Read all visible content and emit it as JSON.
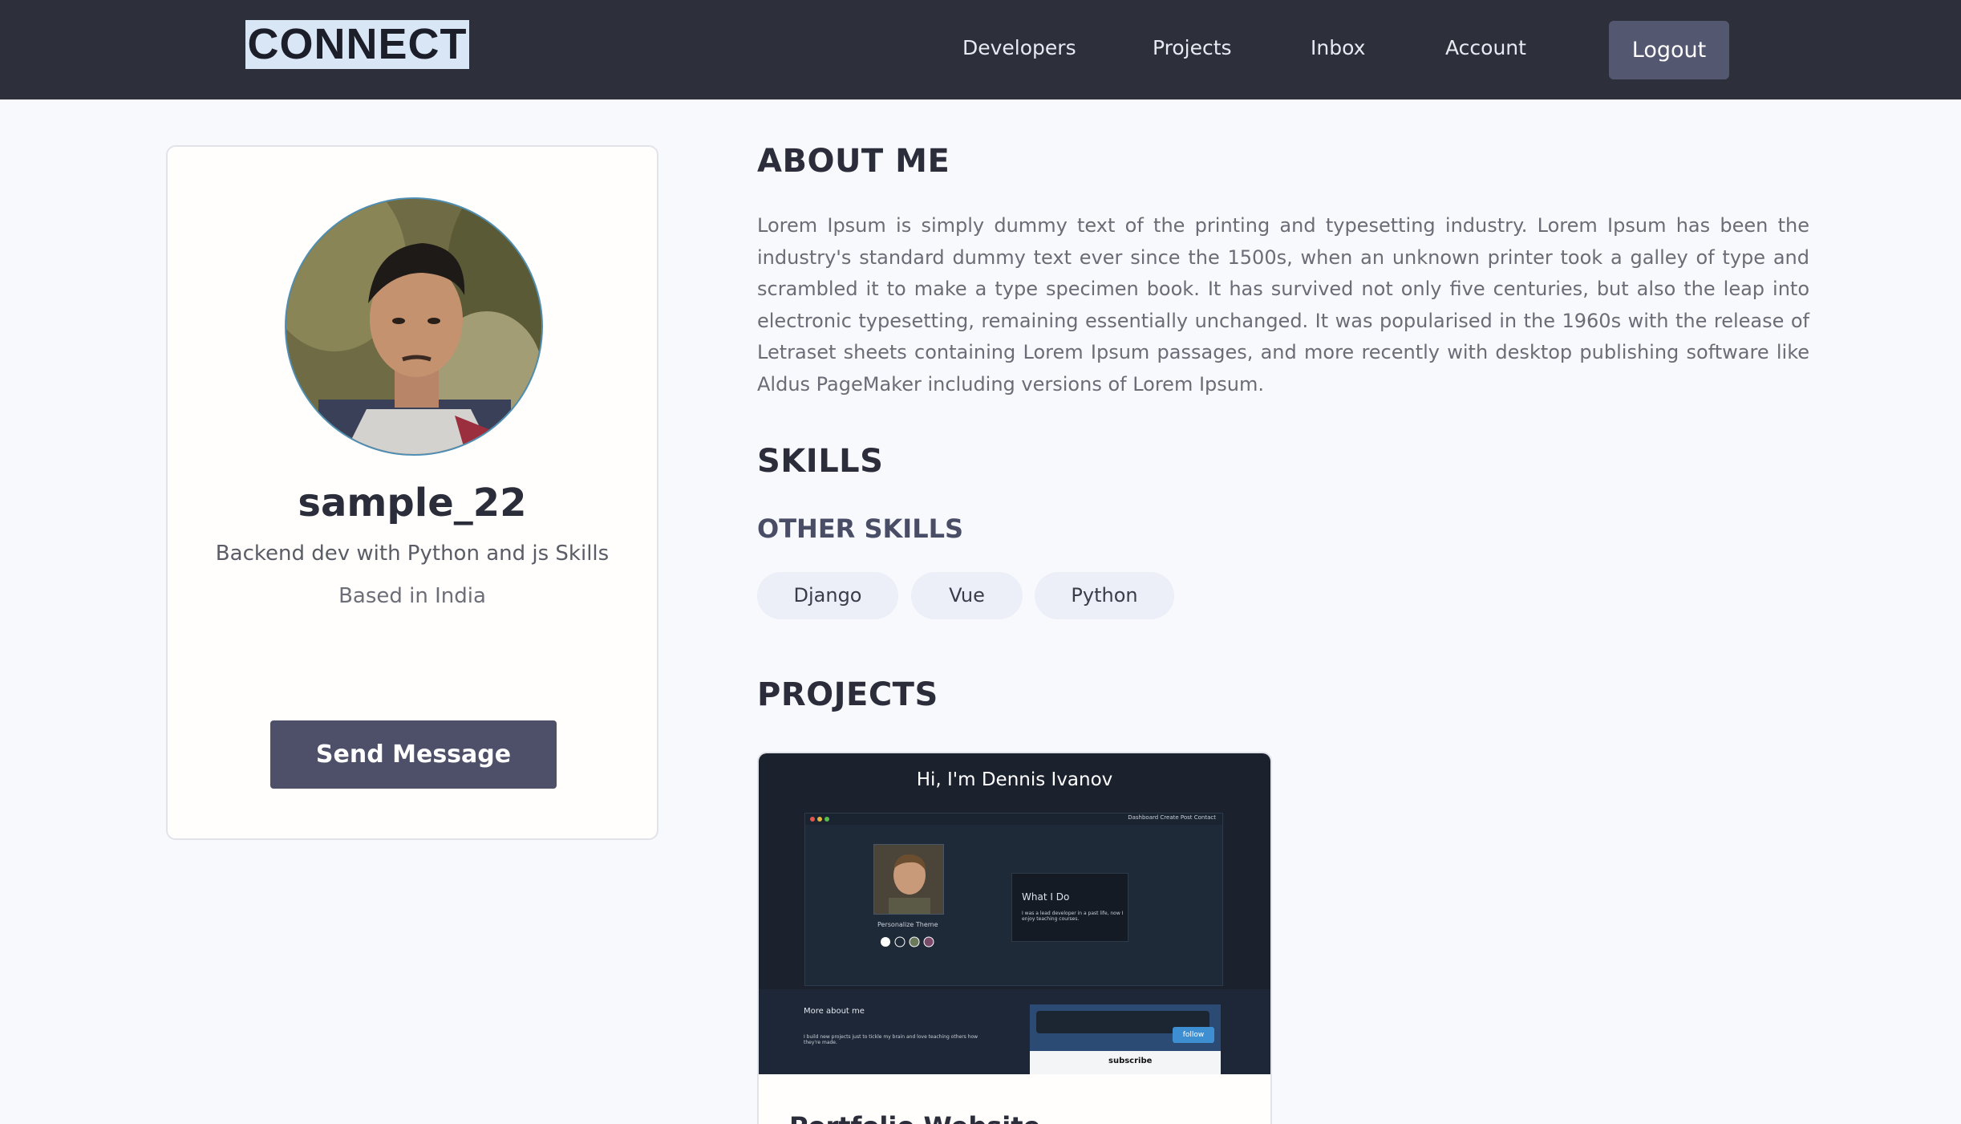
{
  "header": {
    "logo": "CONNECT",
    "nav": [
      "Developers",
      "Projects",
      "Inbox",
      "Account"
    ],
    "logout_label": "Logout"
  },
  "profile": {
    "username": "sample_22",
    "tagline": "Backend dev with Python and js Skills",
    "location": "Based in India",
    "send_message_label": "Send Message"
  },
  "about": {
    "title": "ABOUT ME",
    "text": "Lorem Ipsum is simply dummy text of the printing and typesetting industry. Lorem Ipsum has been the industry's standard dummy text ever since the 1500s, when an unknown printer took a galley of type and scrambled it to make a type specimen book. It has survived not only five centuries, but also the leap into electronic typesetting, remaining essentially unchanged. It was popularised in the 1960s with the release of Letraset sheets containing Lorem Ipsum passages, and more recently with desktop publishing software like Aldus PageMaker including versions of Lorem Ipsum."
  },
  "skills": {
    "title": "SKILLS",
    "other_title": "OTHER SKILLS",
    "tags": [
      "Django",
      "Vue",
      "Python"
    ]
  },
  "projects": {
    "title": "PROJECTS",
    "items": [
      {
        "thumb_heading": "Hi, I'm Dennis Ivanov",
        "thumb_menu": "Dashboard   Create Post   Contact",
        "thumb_theme": "Personalize Theme",
        "thumb_box_title": "What I Do",
        "thumb_box_text": "I was a lead developer in a past life, now I enjoy teaching courses.",
        "thumb_more": "More about me",
        "thumb_more_text": "I build new projects just to tickle my brain and love teaching others how they're made.",
        "thumb_follow": "follow",
        "thumb_subscribe": "subscribe",
        "title": "Portfolio Website"
      }
    ]
  }
}
